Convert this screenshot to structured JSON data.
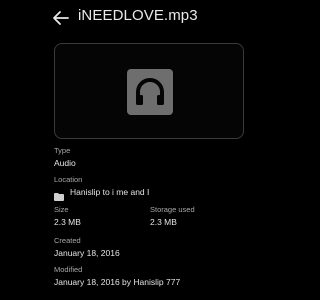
{
  "header": {
    "title": "iNEEDLOVE.mp3"
  },
  "preview": {
    "icon": "headphones-icon",
    "icon_bg": "#6e6e6e"
  },
  "details": {
    "type_label": "Type",
    "type_value": "Audio",
    "location_label": "Location",
    "location_value": "Hanislip to i me and I",
    "size_label": "Size",
    "size_value": "2.3 MB",
    "storage_label": "Storage used",
    "storage_value": "2.3 MB",
    "created_label": "Created",
    "created_value": "January 18, 2016",
    "modified_label": "Modified",
    "modified_value": "January 18, 2016 by Hanislip 777"
  }
}
